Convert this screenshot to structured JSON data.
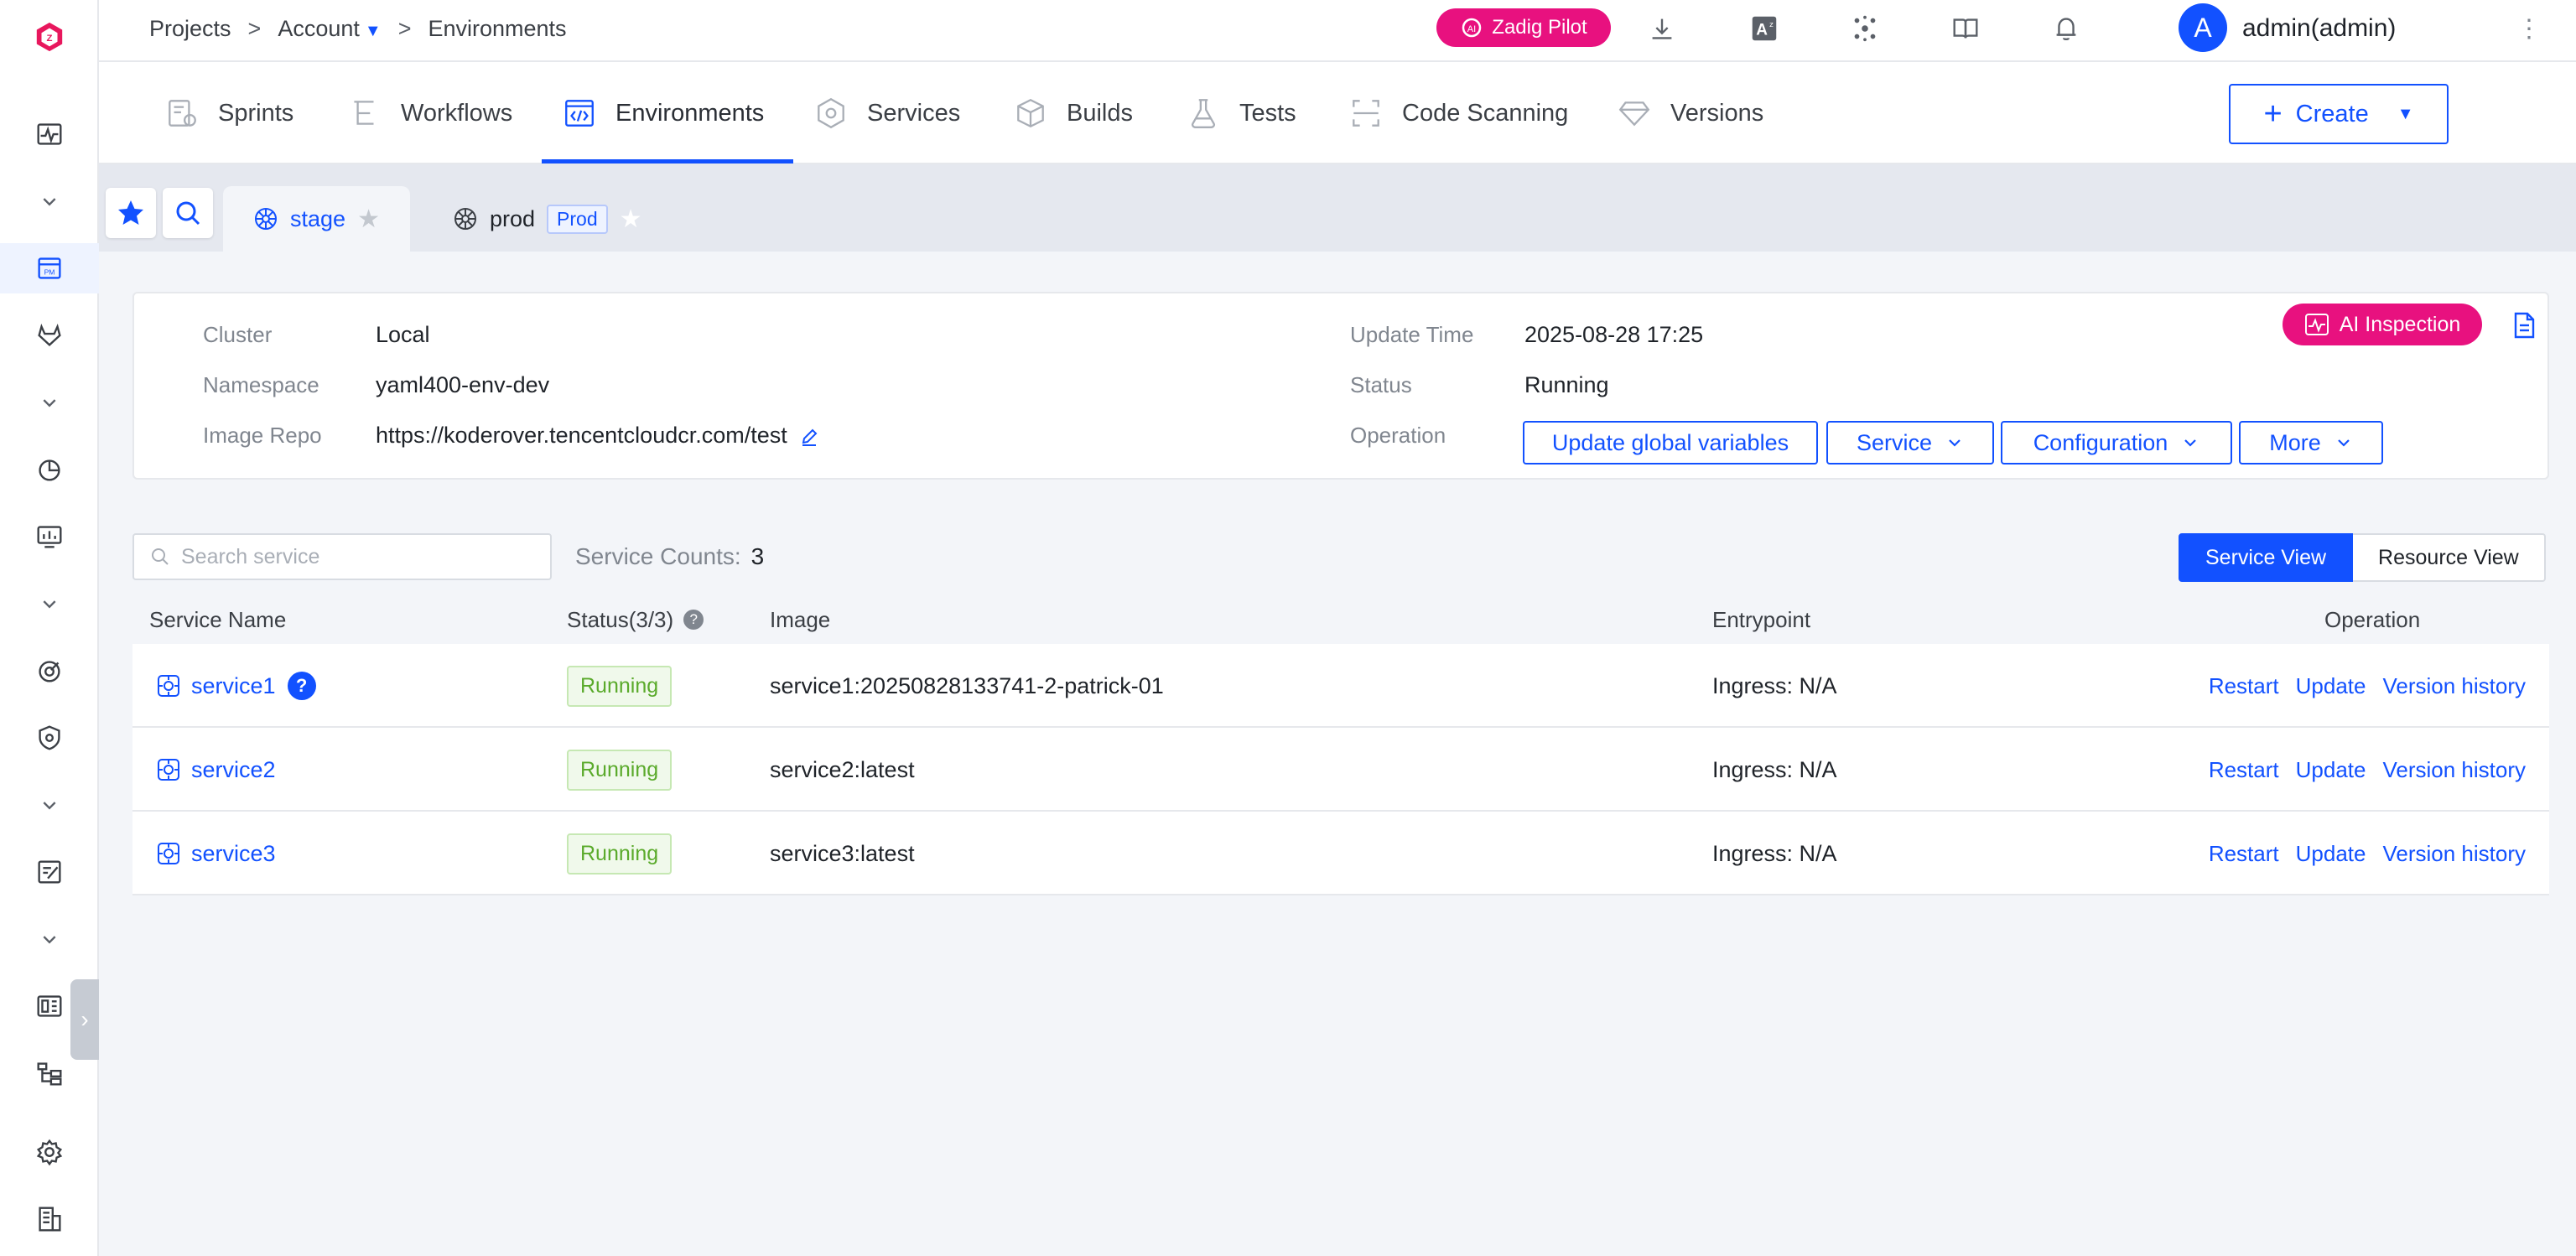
{
  "breadcrumb": {
    "projects": "Projects",
    "account": "Account",
    "environments": "Environments"
  },
  "topbar": {
    "pilot_label": "Zadig Pilot",
    "avatar_letter": "A",
    "user_name": "admin(admin)"
  },
  "nav": {
    "tabs": [
      {
        "label": "Sprints",
        "icon": "sprint-icon"
      },
      {
        "label": "Workflows",
        "icon": "workflow-icon"
      },
      {
        "label": "Environments",
        "icon": "code-icon",
        "active": true
      },
      {
        "label": "Services",
        "icon": "hexagon-icon"
      },
      {
        "label": "Builds",
        "icon": "cube-icon"
      },
      {
        "label": "Tests",
        "icon": "flask-icon"
      },
      {
        "label": "Code Scanning",
        "icon": "scan-icon"
      },
      {
        "label": "Versions",
        "icon": "diamond-icon"
      }
    ],
    "create_label": "Create",
    "accent": "#1251ff"
  },
  "env_tabs": [
    {
      "name": "stage",
      "active": true
    },
    {
      "name": "prod",
      "tag": "Prod"
    }
  ],
  "info": {
    "cluster_label": "Cluster",
    "cluster": "Local",
    "namespace_label": "Namespace",
    "namespace": "yaml400-env-dev",
    "image_repo_label": "Image Repo",
    "image_repo": "https://koderover.tencentcloudcr.com/test",
    "update_time_label": "Update Time",
    "update_time": "2025-08-28 17:25",
    "status_label": "Status",
    "status": "Running",
    "operation_label": "Operation",
    "ai_inspection": "AI Inspection",
    "ops": {
      "update_vars": "Update global variables",
      "service": "Service",
      "configuration": "Configuration",
      "more": "More"
    }
  },
  "services": {
    "search_placeholder": "Search service",
    "count_label": "Service Counts:",
    "count": "3",
    "views": {
      "service": "Service View",
      "resource": "Resource View"
    },
    "headers": {
      "name": "Service Name",
      "status": "Status(3/3)",
      "image": "Image",
      "entrypoint": "Entrypoint",
      "operation": "Operation"
    },
    "rows": [
      {
        "name": "service1",
        "status": "Running",
        "image": "service1:20250828133741-2-patrick-01",
        "entrypoint": "Ingress:  N/A",
        "help": "?"
      },
      {
        "name": "service2",
        "status": "Running",
        "image": "service2:latest",
        "entrypoint": "Ingress:  N/A"
      },
      {
        "name": "service3",
        "status": "Running",
        "image": "service3:latest",
        "entrypoint": "Ingress:  N/A"
      }
    ],
    "row_ops": {
      "restart": "Restart",
      "update": "Update",
      "history": "Version history"
    }
  }
}
